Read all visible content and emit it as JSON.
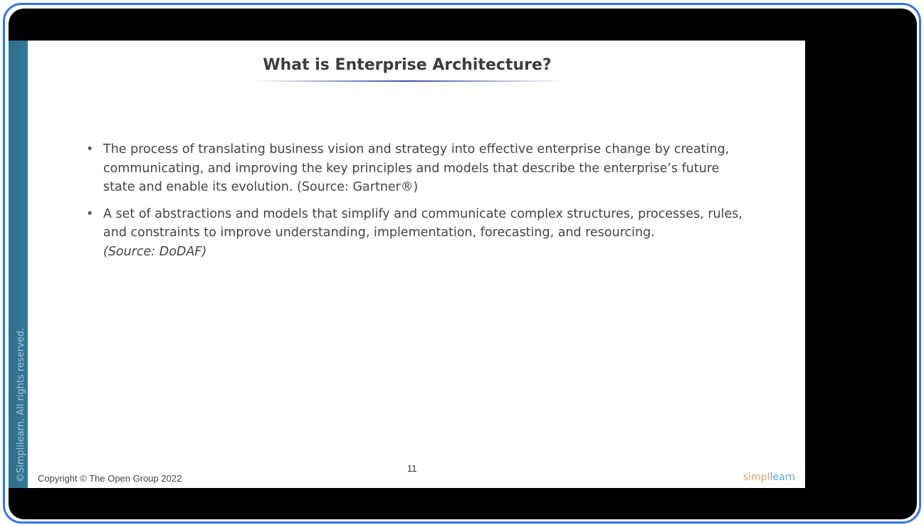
{
  "slide": {
    "title": "What is Enterprise Architecture?",
    "bullets": [
      {
        "text": "The process of translating business vision and strategy into effective enterprise change by creating, communicating, and improving the key principles and models that describe the enterprise’s future state and enable its evolution. (Source: Gartner®)",
        "source": ""
      },
      {
        "text": "A set of abstractions and models that simplify and communicate complex structures, processes, rules, and constraints to improve understanding, implementation, forecasting, and resourcing.",
        "source": "(Source: DoDAF)"
      }
    ],
    "page_number": "11",
    "copyright": "Copyright © The Open Group 2022",
    "side_text": "©Simplilearn. All rights reserved.",
    "logo": {
      "part1": "simpl",
      "part2": "learn"
    }
  },
  "colors": {
    "frame": "#3a74e0",
    "stripe": "#2e6e8c",
    "logo_orange": "#e8a068",
    "logo_blue": "#5aa7e0"
  }
}
